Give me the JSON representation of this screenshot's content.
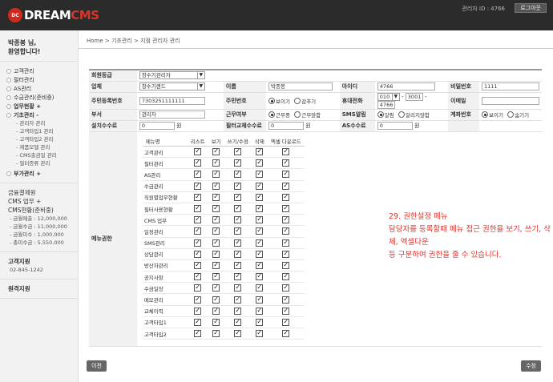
{
  "app": {
    "logo_mark": "DC",
    "logo_text": "DREAM",
    "logo_text_accent": "CMS",
    "manager_id": "관리자 ID : 4766",
    "logout": "로그아웃"
  },
  "sidebar": {
    "user_line1": "박종봉 님,",
    "user_line2": "환영합니다!",
    "menu": [
      {
        "label": "고객관리"
      },
      {
        "label": "필터관리"
      },
      {
        "label": "AS관리"
      },
      {
        "label": "수금관리(준비중)"
      },
      {
        "label": "업무현황 +"
      },
      {
        "label": "기초관리 -"
      }
    ],
    "sub": [
      "- 관리자 관리",
      "- 고객타입1 관리",
      "- 고객타입2 관리",
      "- 제품모델 관리",
      "- CMS출금일 관리",
      "- 필터종류 관리"
    ],
    "extra": "부가관리 +",
    "finance_title": "금융결제원",
    "finance_items": [
      "CMS 업무 +",
      "CMS현황(준비중)"
    ],
    "stats": [
      "- 금월매출 : 12,000,000",
      "- 금월수금 : 11,000,000",
      "- 금월미수 : 1,000,000",
      "- 총미수금 : 5,550,000"
    ],
    "support_title": "고객지원",
    "support_phone": "02-845-1242",
    "remote": "원격지원"
  },
  "breadcrumb": "Home > 기초관리 > 지점 관리자 관리",
  "form": {
    "grade_label": "회원등급",
    "grade_value": "창수기관리자",
    "company_label": "업체",
    "company_value": "창수기랜드",
    "name_label": "이름",
    "name_value": "박종봉",
    "id_label": "아이디",
    "id_value": "4766",
    "pw_label": "비밀번호",
    "pw_value": "1111",
    "rrn_label": "주민등록번호",
    "rrn_value": "7303251111111",
    "rrn_view_label": "주민번호",
    "opt_show": "보이기",
    "opt_hide": "감추기",
    "mobile_label": "휴대전화",
    "mobile_1": "010",
    "mobile_2": "3001",
    "mobile_3": "4766",
    "dash": "-",
    "email_label": "이메일",
    "dept_label": "부서",
    "dept_value": "관리자",
    "work_label": "근무여부",
    "opt_working": "근무중",
    "opt_notworking": "근무않함",
    "sms_label": "SMS알림",
    "opt_notify": "알림",
    "opt_nonotify": "알리지않함",
    "acct_label": "계좌번호",
    "opt_show2": "보이기",
    "opt_hide2": "숨기기",
    "install_fee_label": "설치수수료",
    "install_fee_value": "0",
    "won": "원",
    "filter_fee_label": "필터교체수수료",
    "filter_fee_value": "0",
    "as_fee_label": "AS수수료",
    "as_fee_value": "0",
    "perm_label": "메뉴권한"
  },
  "perm": {
    "headers": [
      "메뉴명",
      "리스트",
      "보기",
      "쓰기/수정",
      "삭제",
      "엑셀 다운로드"
    ],
    "rows": [
      "고객관리",
      "필터관리",
      "AS관리",
      "수금관리",
      "직원별업무현황",
      "필터사용현황",
      "CMS 업무",
      "일정관리",
      "SMS관리",
      "상담관리",
      "방산자관리",
      "공지사항",
      "수금일장",
      "메모관리",
      "교체이력",
      "고객타입1",
      "고객타입2"
    ]
  },
  "annotation": {
    "line1": "29. 권한설정 메뉴",
    "line2": "담당자를 등록할때 메뉴 접근 권한을 보기, 쓰기, 삭제, 엑셀다운",
    "line3": "등 구분하여 권한을 줄 수 있습니다."
  },
  "buttons": {
    "prev": "이전",
    "edit": "수정"
  }
}
